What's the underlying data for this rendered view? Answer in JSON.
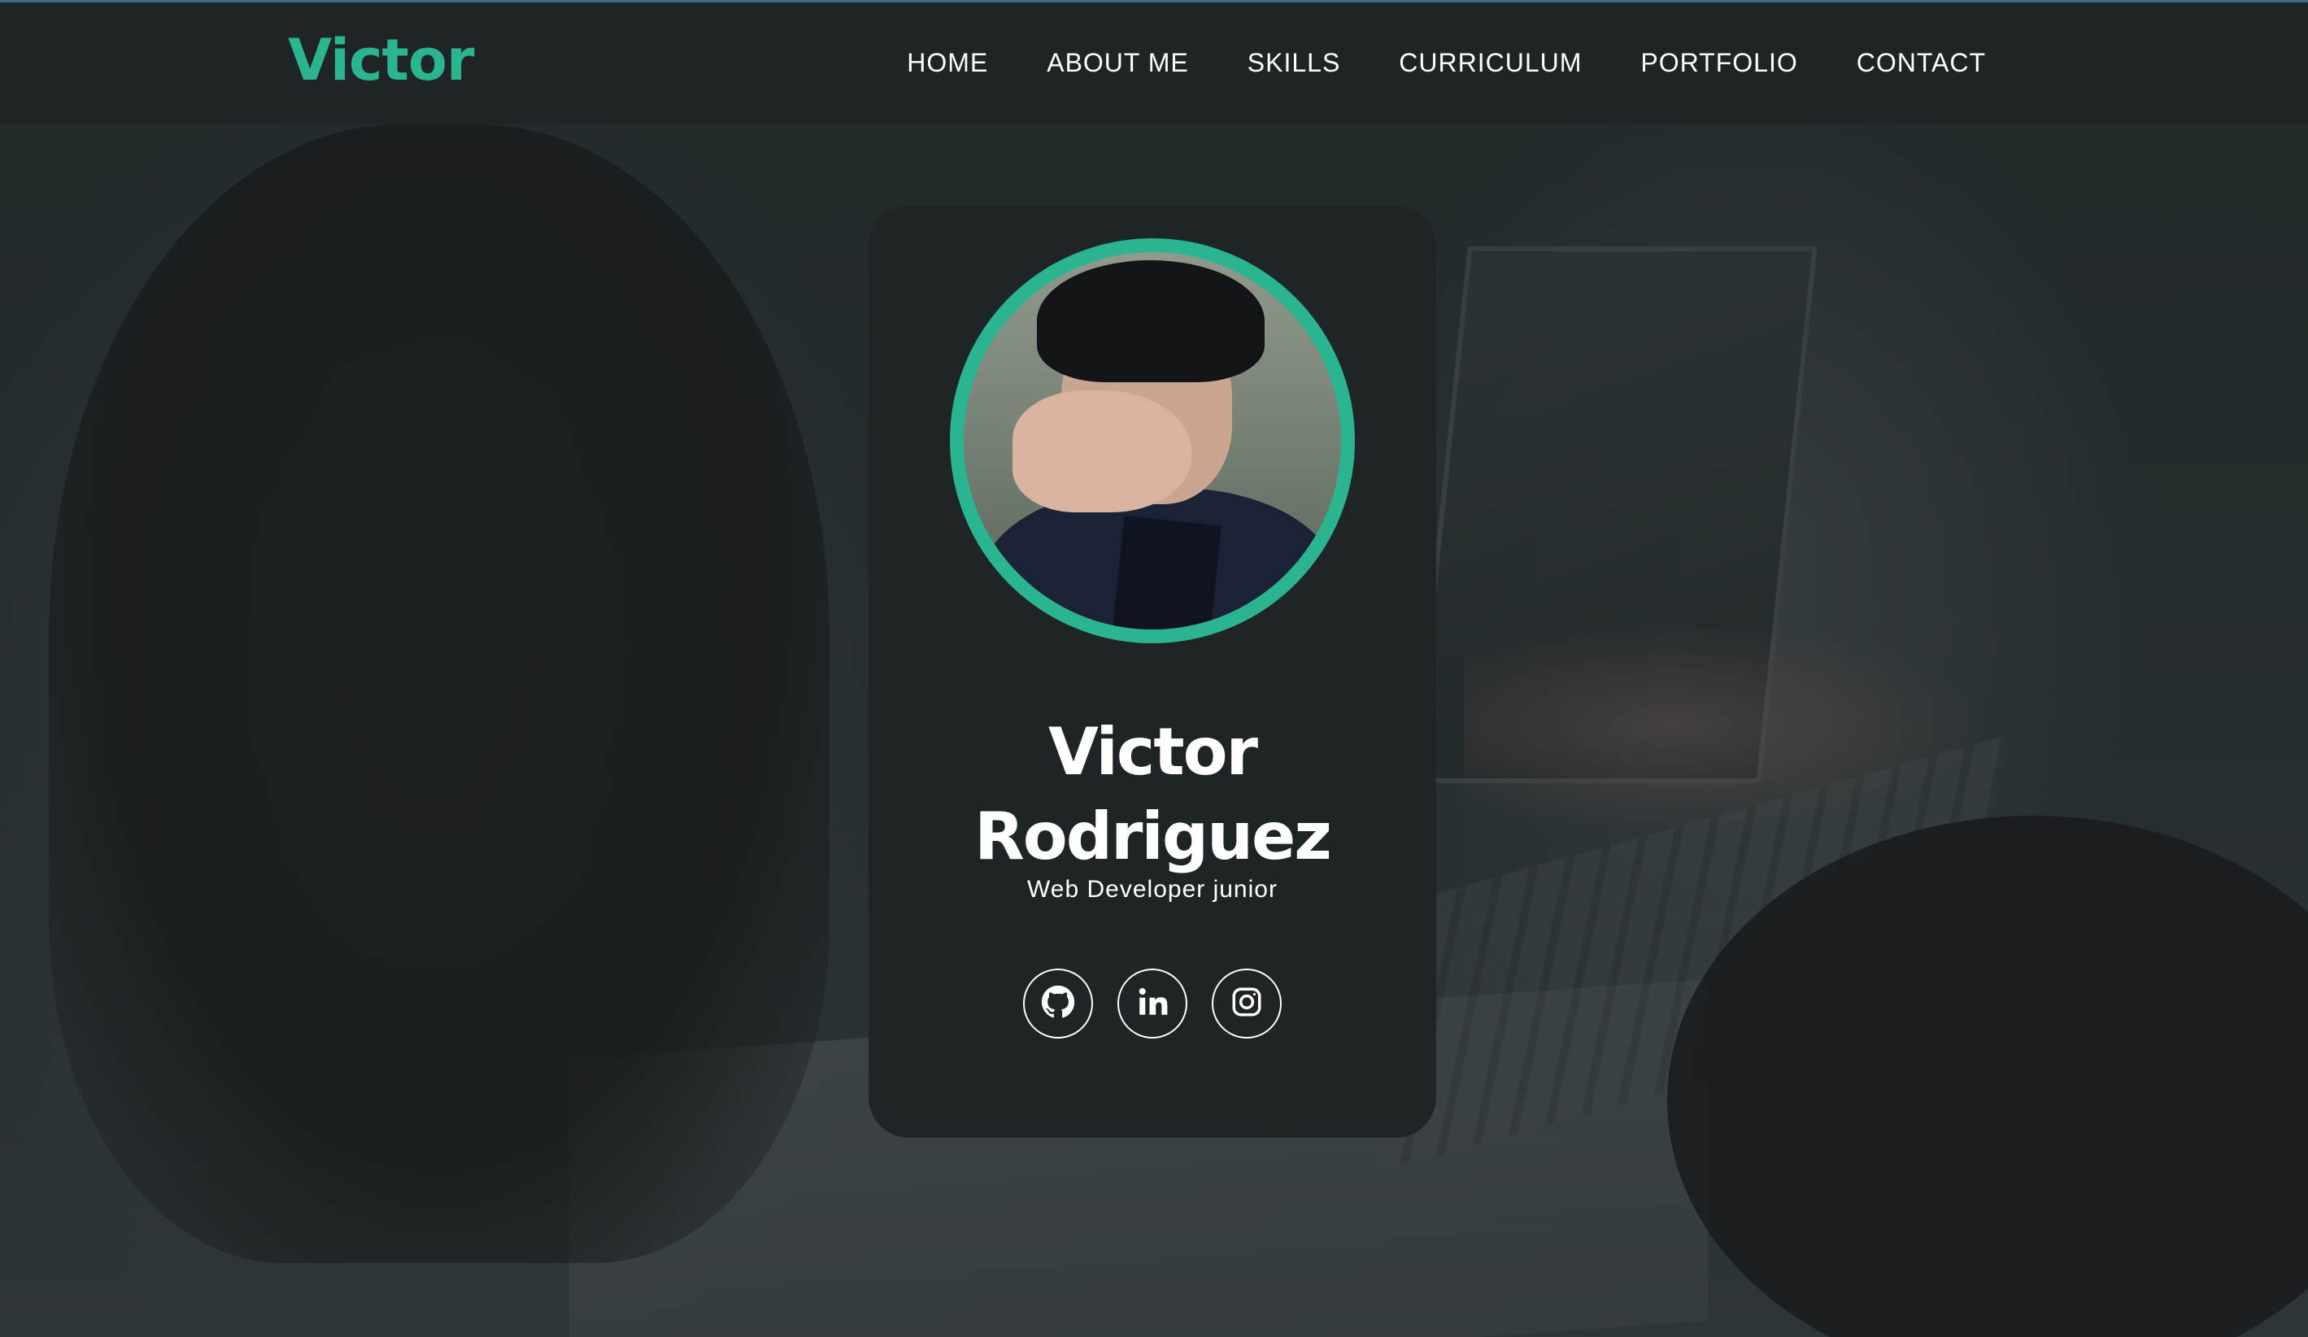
{
  "brand": {
    "name": "Victor"
  },
  "nav": {
    "items": [
      {
        "label": "HOME"
      },
      {
        "label": "ABOUT ME"
      },
      {
        "label": "SKILLS"
      },
      {
        "label": "CURRICULUM"
      },
      {
        "label": "PORTFOLIO"
      },
      {
        "label": "CONTACT"
      }
    ]
  },
  "profile": {
    "first_name": "Victor",
    "last_name": "Rodriguez",
    "role": "Web Developer junior",
    "socials": [
      {
        "icon": "github-icon"
      },
      {
        "icon": "linkedin-icon"
      },
      {
        "icon": "instagram-icon"
      }
    ]
  },
  "colors": {
    "accent": "#2ab490",
    "navbar_bg": "#1f2526",
    "card_bg": "#1f2526",
    "text": "#ffffff"
  }
}
